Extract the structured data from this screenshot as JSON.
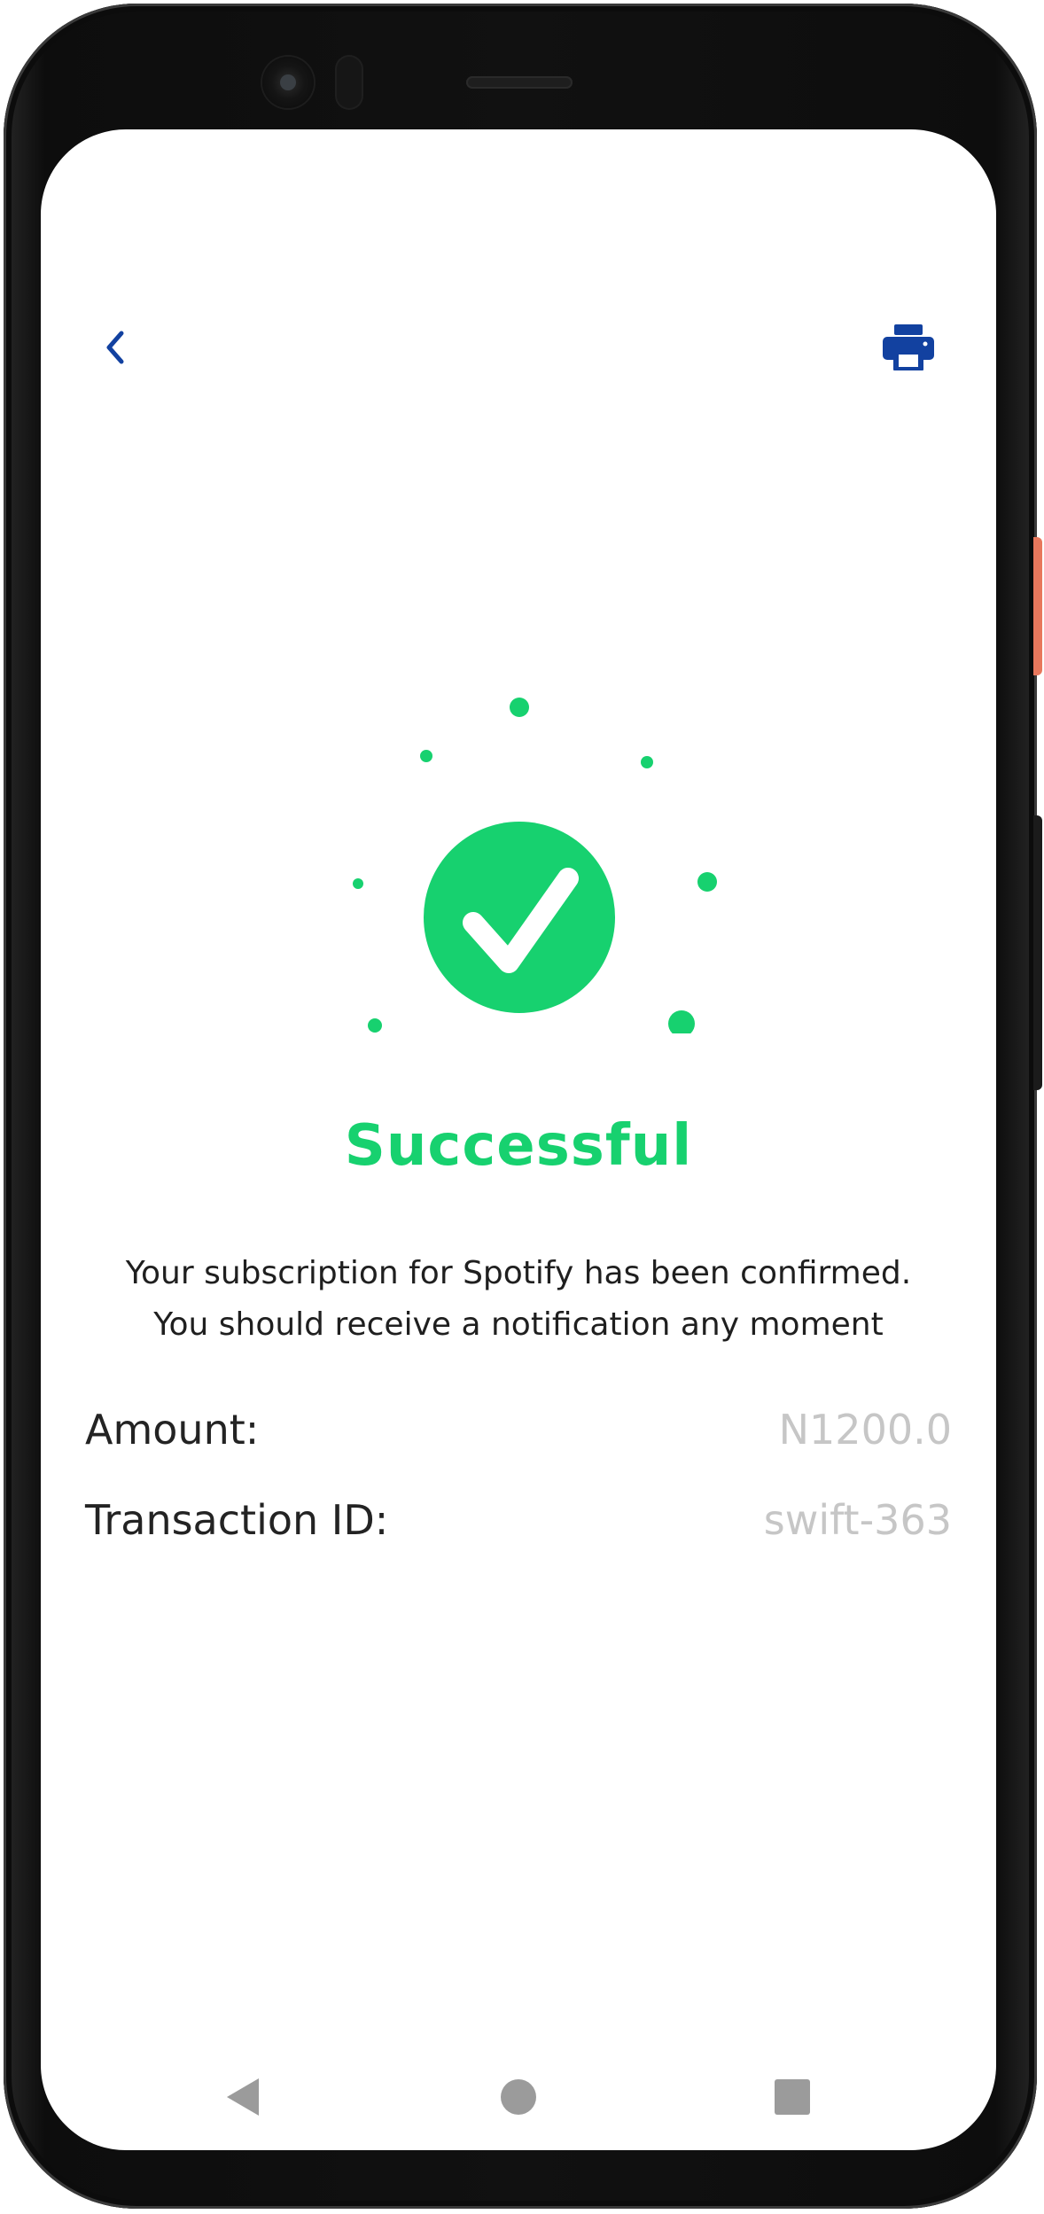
{
  "colors": {
    "accent_green": "#17d16f",
    "icon_blue": "#1241a0",
    "label_text": "#232323",
    "value_text": "#c6c6c6",
    "nav_gray": "#9b9b9b"
  },
  "header": {
    "back_icon": "chevron-left-icon",
    "print_icon": "printer-icon"
  },
  "status": {
    "icon": "check-circle-icon",
    "title": "Successful",
    "message_line1": "Your subscription for Spotify has been confirmed.",
    "message_line2": "You should receive a notification any moment"
  },
  "details": {
    "amount_label": "Amount:",
    "amount_value": "N1200.0",
    "transaction_label": "Transaction ID:",
    "transaction_value": "swift-363"
  },
  "navbar": {
    "back_icon": "triangle-back-icon",
    "home_icon": "circle-home-icon",
    "recent_icon": "square-recents-icon"
  }
}
